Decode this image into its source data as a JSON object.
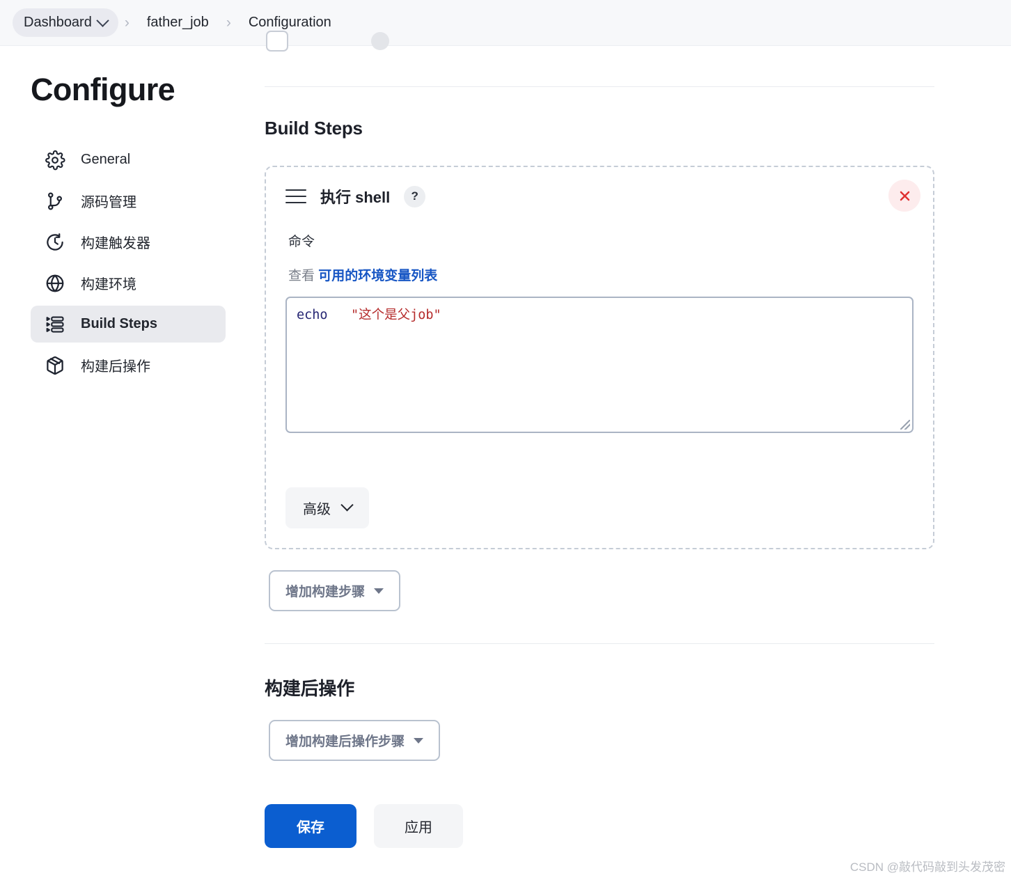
{
  "breadcrumb": {
    "items": [
      {
        "label": "Dashboard",
        "has_dropdown": true
      },
      {
        "label": "father_job",
        "has_dropdown": false
      },
      {
        "label": "Configuration",
        "has_dropdown": false
      }
    ],
    "separator": "›"
  },
  "sidebar": {
    "title": "Configure",
    "items": [
      {
        "label": "General",
        "icon": "gear-icon",
        "active": false
      },
      {
        "label": "源码管理",
        "icon": "branch-icon",
        "active": false
      },
      {
        "label": "构建触发器",
        "icon": "clock-icon",
        "active": false
      },
      {
        "label": "构建环境",
        "icon": "globe-icon",
        "active": false
      },
      {
        "label": "Build Steps",
        "icon": "list-steps-icon",
        "active": true
      },
      {
        "label": "构建后操作",
        "icon": "package-icon",
        "active": false
      }
    ]
  },
  "main": {
    "build_steps_heading": "Build Steps",
    "step_card": {
      "drag_handle_icon": "drag-handle-icon",
      "title": "执行 shell",
      "help_label": "?",
      "close_icon": "close-icon",
      "command_label": "命令",
      "env_var_prefix": "查看",
      "env_var_link": "可用的环境变量列表",
      "command_value": "echo \"这个是父job\"",
      "command_tokens": {
        "keyword": "echo",
        "string": "\"这个是父job\""
      },
      "advanced_label": "高级"
    },
    "add_build_step_label": "增加构建步骤",
    "post_build_heading": "构建后操作",
    "add_post_build_step_label": "增加构建后操作步骤"
  },
  "footer": {
    "save_label": "保存",
    "apply_label": "应用"
  },
  "watermark": "CSDN @敲代码敲到头发茂密",
  "colors": {
    "accent_blue": "#0b5ed0",
    "link_blue": "#1756c4",
    "close_red": "#e03131",
    "close_bg": "#fdeced",
    "active_nav_bg": "#e9eaee",
    "dashed_border": "#c5ccd6",
    "code_keyword": "#262673",
    "code_string": "#b52b2b"
  }
}
